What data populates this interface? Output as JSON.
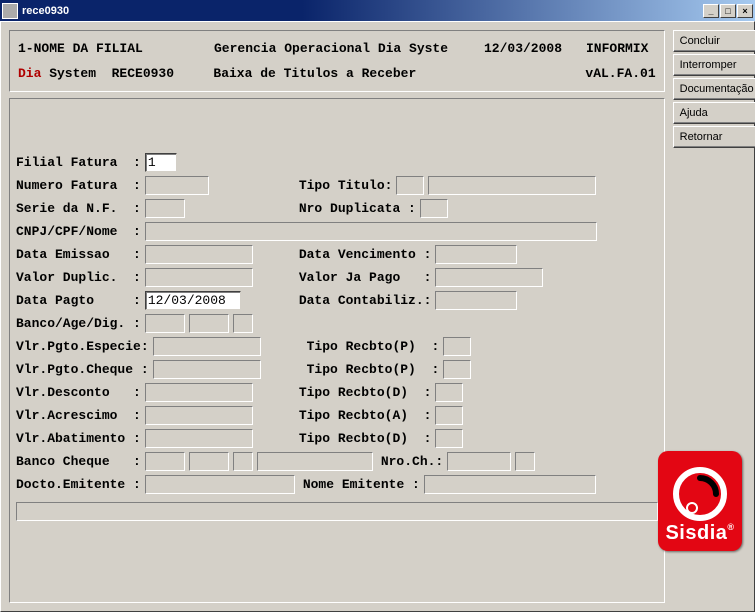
{
  "window": {
    "title": "rece0930"
  },
  "header": {
    "line1_left": "1-NOME DA FILIAL",
    "line1_mid": "Gerencia Operacional Dia Syste",
    "line1_date": "12/03/2008",
    "line1_right": "INFORMIX",
    "line2_dia": "Dia",
    "line2_system": " System  RECE0930",
    "line2_mid": "Baixa de Titulos a Receber",
    "line2_right": "vAL.FA.01"
  },
  "labels": {
    "filial_fatura": "Filial Fatura  :",
    "numero_fatura": "Numero Fatura  :",
    "tipo_titulo": "Tipo Titulo:",
    "serie_nf": "Serie da N.F.  :",
    "nro_duplicata": "Nro Duplicata :",
    "cnpj_cpf_nome": "CNPJ/CPF/Nome  :",
    "data_emissao": "Data Emissao   :",
    "data_vencto": "Data Vencimento :",
    "valor_duplic": "Valor Duplic.  :",
    "valor_ja_pago": "Valor Ja Pago   :",
    "data_pagto": "Data Pagto     :",
    "data_contab": "Data Contabiliz.:",
    "banco_age_dig": "Banco/Age/Dig. :",
    "vlr_pgto_especie": "Vlr.Pgto.Especie:",
    "tipo_recbto_p": "Tipo Recbto(P)  :",
    "vlr_pgto_cheque": "Vlr.Pgto.Cheque :",
    "tipo_recbto_p2": "Tipo Recbto(P)  :",
    "vlr_desconto": "Vlr.Desconto   :",
    "tipo_recbto_d": "Tipo Recbto(D)  :",
    "vlr_acrescimo": "Vlr.Acrescimo  :",
    "tipo_recbto_a": "Tipo Recbto(A)  :",
    "vlr_abatimento": "Vlr.Abatimento :",
    "tipo_recbto_d2": "Tipo Recbto(D)  :",
    "banco_cheque": "Banco Cheque   :",
    "nro_ch": "Nro.Ch.:",
    "docto_emitente": "Docto.Emitente :",
    "nome_emitente": "Nome Emitente :"
  },
  "values": {
    "filial_fatura": "1",
    "data_pagto": "12/03/2008"
  },
  "buttons": {
    "concluir": "Concluir",
    "interromper": "Interromper",
    "documentacao": "Documentação",
    "ajuda": "Ajuda",
    "retornar": "Retornar"
  },
  "logo": {
    "text": "Sisdia"
  }
}
